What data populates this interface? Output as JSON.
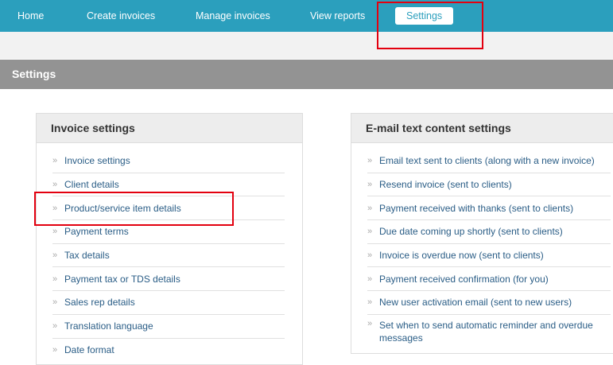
{
  "nav": {
    "items": [
      "Home",
      "Create invoices",
      "Manage invoices",
      "View reports",
      "Settings"
    ]
  },
  "page": {
    "title": "Settings"
  },
  "invoice_settings": {
    "title": "Invoice settings",
    "items": [
      "Invoice settings",
      "Client details",
      "Product/service item details",
      "Payment terms",
      "Tax details",
      "Payment tax or TDS details",
      "Sales rep details",
      "Translation language",
      "Date format"
    ]
  },
  "email_settings": {
    "title": "E-mail text content settings",
    "items": [
      "Email text sent to clients (along with a new invoice)",
      "Resend invoice (sent to clients)",
      "Payment received with thanks (sent to clients)",
      "Due date coming up shortly (sent to clients)",
      "Invoice is overdue now (sent to clients)",
      "Payment received confirmation (for you)",
      "New user activation email (sent to new users)",
      "Set when to send automatic reminder and overdue messages"
    ]
  },
  "colors": {
    "nav_bg": "#2b9fbd",
    "section_bar": "#939393",
    "link": "#2a5d86",
    "annotation_red": "#e3000f"
  }
}
